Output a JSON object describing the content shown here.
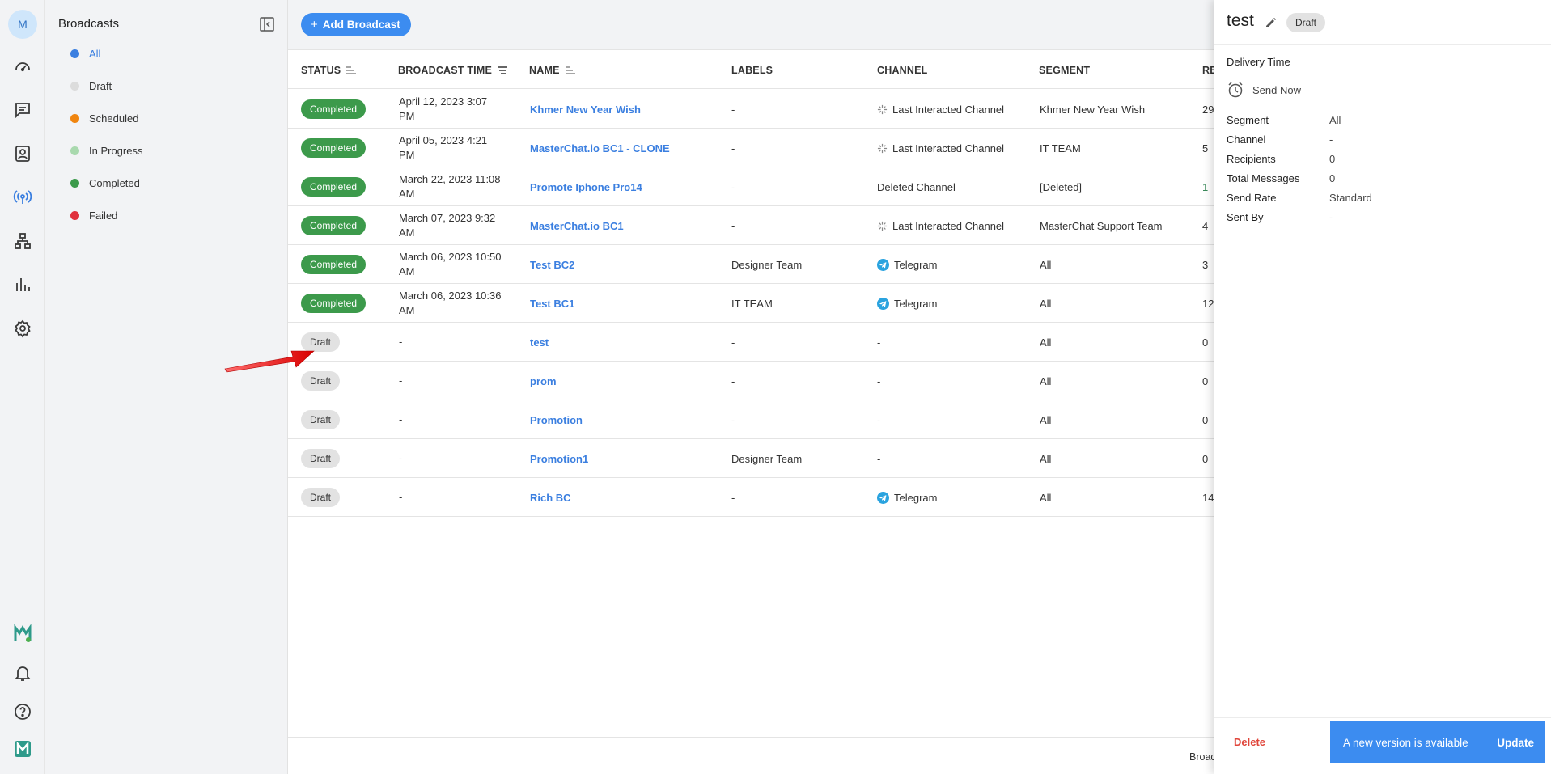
{
  "rail": {
    "avatar_letter": "M",
    "icons": [
      "dashboard-icon",
      "chat-icon",
      "contacts-icon",
      "broadcast-icon",
      "workflow-icon",
      "reports-icon",
      "settings-icon",
      "brand-logo-icon",
      "bell-icon",
      "help-icon",
      "app-logo-icon"
    ]
  },
  "sidebar": {
    "title": "Broadcasts",
    "items": [
      {
        "label": "All",
        "color": "#3b7fe0",
        "active": true
      },
      {
        "label": "Draft",
        "color": "#dcdcdc",
        "active": false
      },
      {
        "label": "Scheduled",
        "color": "#f0850f",
        "active": false
      },
      {
        "label": "In Progress",
        "color": "#a9d9ae",
        "active": false
      },
      {
        "label": "Completed",
        "color": "#3c9a4b",
        "active": false
      },
      {
        "label": "Failed",
        "color": "#e0303c",
        "active": false
      }
    ]
  },
  "toolbar": {
    "add_label": "Add Broadcast"
  },
  "table": {
    "headers": {
      "status": "STATUS",
      "time": "BROADCAST TIME",
      "name": "NAME",
      "labels": "LABELS",
      "channel": "CHANNEL",
      "segment": "SEGMENT",
      "recipients": "RE"
    },
    "rows": [
      {
        "status": "Completed",
        "time1": "April 12, 2023 3:07",
        "time2": "PM",
        "name": "Khmer New Year Wish",
        "labels": "-",
        "channel": "Last Interacted Channel",
        "channel_icon": "last-interacted-icon",
        "segment": "Khmer New Year Wish",
        "recipients": "29"
      },
      {
        "status": "Completed",
        "time1": "April 05, 2023 4:21",
        "time2": "PM",
        "name": "MasterChat.io BC1 - CLONE",
        "labels": "-",
        "channel": "Last Interacted Channel",
        "channel_icon": "last-interacted-icon",
        "segment": "IT TEAM",
        "recipients": "5"
      },
      {
        "status": "Completed",
        "time1": "March 22, 2023 11:08",
        "time2": "AM",
        "name": "Promote Iphone Pro14",
        "labels": "-",
        "channel": "Deleted Channel",
        "channel_icon": "",
        "segment": "[Deleted]",
        "recipients": "1"
      },
      {
        "status": "Completed",
        "time1": "March 07, 2023 9:32",
        "time2": "AM",
        "name": "MasterChat.io BC1",
        "labels": "-",
        "channel": "Last Interacted Channel",
        "channel_icon": "last-interacted-icon",
        "segment": "MasterChat Support Team",
        "recipients": "4"
      },
      {
        "status": "Completed",
        "time1": "March 06, 2023 10:50",
        "time2": "AM",
        "name": "Test BC2",
        "labels": "Designer Team",
        "channel": "Telegram",
        "channel_icon": "telegram-icon",
        "segment": "All",
        "recipients": "3"
      },
      {
        "status": "Completed",
        "time1": "March 06, 2023 10:36",
        "time2": "AM",
        "name": "Test BC1",
        "labels": "IT TEAM",
        "channel": "Telegram",
        "channel_icon": "telegram-icon",
        "segment": "All",
        "recipients": "12"
      },
      {
        "status": "Draft",
        "time1": "-",
        "time2": "",
        "name": "test",
        "labels": "-",
        "channel": "-",
        "channel_icon": "",
        "segment": "All",
        "recipients": "0"
      },
      {
        "status": "Draft",
        "time1": "-",
        "time2": "",
        "name": "prom",
        "labels": "-",
        "channel": "-",
        "channel_icon": "",
        "segment": "All",
        "recipients": "0"
      },
      {
        "status": "Draft",
        "time1": "-",
        "time2": "",
        "name": "Promotion",
        "labels": "-",
        "channel": "-",
        "channel_icon": "",
        "segment": "All",
        "recipients": "0"
      },
      {
        "status": "Draft",
        "time1": "-",
        "time2": "",
        "name": "Promotion1",
        "labels": "Designer Team",
        "channel": "-",
        "channel_icon": "",
        "segment": "All",
        "recipients": "0"
      },
      {
        "status": "Draft",
        "time1": "-",
        "time2": "",
        "name": "Rich BC",
        "labels": "-",
        "channel": "Telegram",
        "channel_icon": "telegram-icon",
        "segment": "All",
        "recipients": "14"
      }
    ],
    "footer_text": "Broad"
  },
  "panel": {
    "title": "test",
    "status": "Draft",
    "delivery_time_label": "Delivery Time",
    "send_now": "Send Now",
    "fields": [
      {
        "key": "Segment",
        "value": "All"
      },
      {
        "key": "Channel",
        "value": "-"
      },
      {
        "key": "Recipients",
        "value": "0"
      },
      {
        "key": "Total Messages",
        "value": "0"
      },
      {
        "key": "Send Rate",
        "value": "Standard"
      },
      {
        "key": "Sent By",
        "value": "-"
      }
    ],
    "delete_label": "Delete",
    "toast_message": "A new version is available",
    "toast_action": "Update"
  }
}
